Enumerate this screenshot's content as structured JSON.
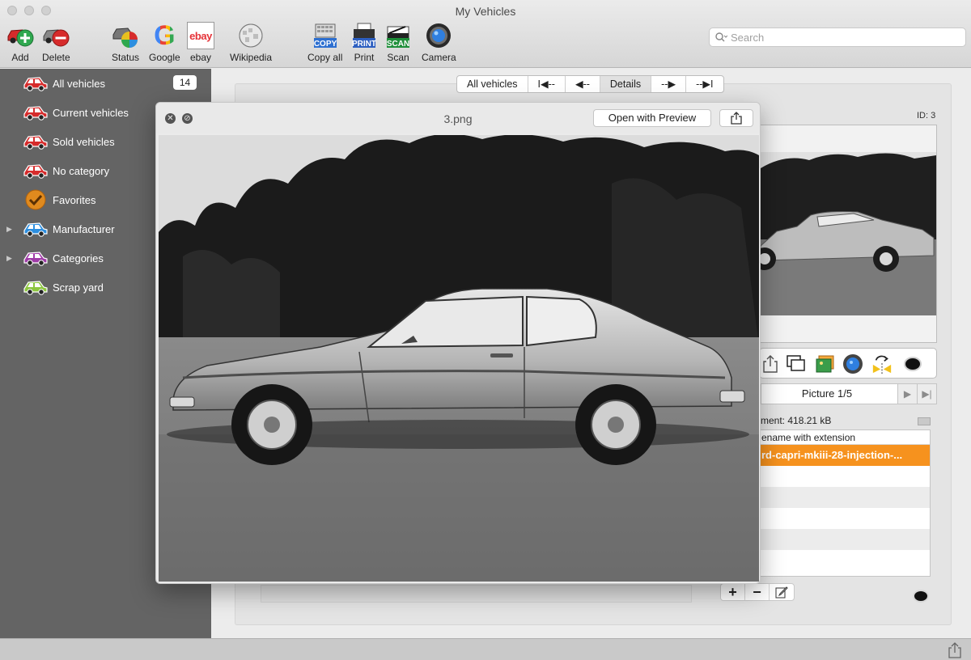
{
  "window": {
    "title": "My Vehicles"
  },
  "toolbar": {
    "add": "Add",
    "delete": "Delete",
    "status": "Status",
    "google": "Google",
    "ebay": "ebay",
    "wikipedia": "Wikipedia",
    "copy_all": "Copy all",
    "print": "Print",
    "scan": "Scan",
    "camera": "Camera",
    "copy_tag": "COPY",
    "print_tag": "PRINT",
    "scan_tag": "SCAN",
    "ebay_logo": "ebay",
    "google_logo": "G"
  },
  "search": {
    "placeholder": "Search"
  },
  "sidebar": {
    "items": [
      {
        "label": "All vehicles",
        "count": "14",
        "color": "#d62b2b"
      },
      {
        "label": "Current vehicles",
        "color": "#d62b2b"
      },
      {
        "label": "Sold vehicles",
        "color": "#d62b2b"
      },
      {
        "label": "No category",
        "color": "#d62b2b"
      },
      {
        "label": "Favorites",
        "color": "#e08a1e"
      },
      {
        "label": "Manufacturer",
        "color": "#2d8fe0"
      },
      {
        "label": "Categories",
        "color": "#a03ca8"
      },
      {
        "label": "Scrap yard",
        "color": "#8cc63f"
      }
    ]
  },
  "nav": {
    "all_vehicles": "All vehicles",
    "first": "I◀--",
    "prev": "◀--",
    "details": "Details",
    "next": "--▶",
    "last": "--▶I"
  },
  "details": {
    "id_label": "ID: 3",
    "picture_label": "Picture 1/5",
    "attachment_size": "ment: 418.21 kB",
    "file_header": "ename with extension",
    "file_selected": "rd-capri-mkiii-28-injection-..."
  },
  "quicklook": {
    "filename": "3.png",
    "open_with": "Open with Preview"
  }
}
